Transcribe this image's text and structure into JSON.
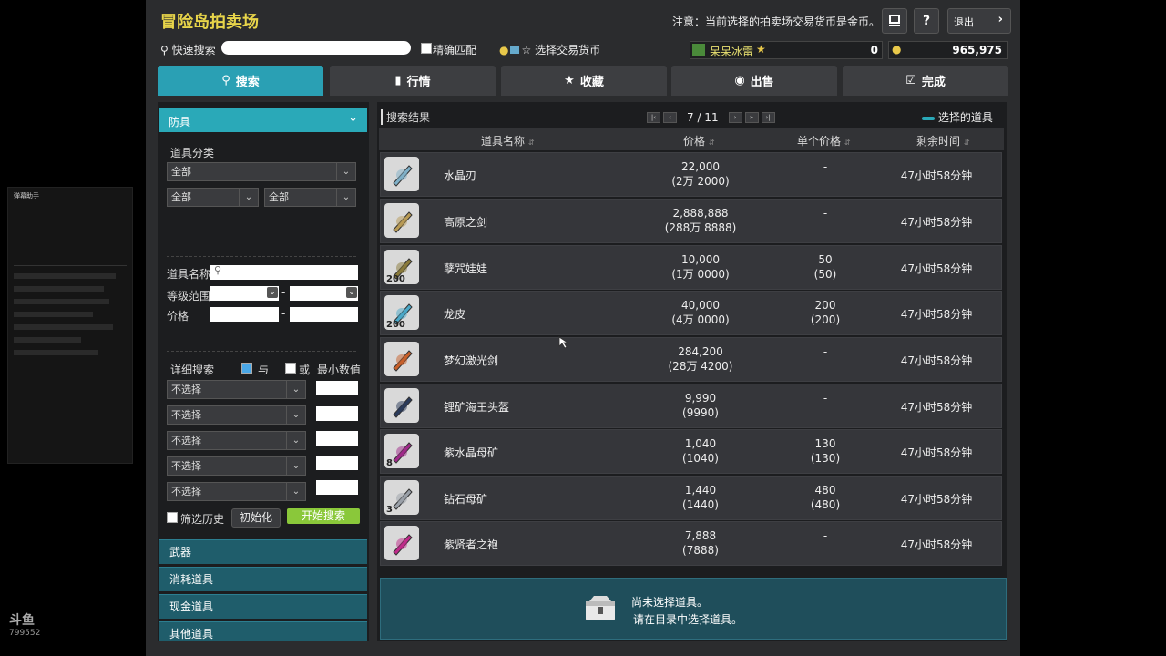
{
  "header": {
    "title": "冒险岛拍卖场",
    "notice": "注意：当前选择的拍卖场交易货币是金币。",
    "quit_label": "退出"
  },
  "search_bar": {
    "quick_search_label": "快速搜索",
    "quick_search_value": "",
    "exact_match_label": "精确匹配",
    "currency_label": "选择交易货币",
    "username": "呆呆冰雷",
    "points": "0",
    "gold": "965,975"
  },
  "tabs": [
    {
      "label": "搜索",
      "icon": "search-icon"
    },
    {
      "label": "行情",
      "icon": "chart-icon"
    },
    {
      "label": "收藏",
      "icon": "star-icon"
    },
    {
      "label": "出售",
      "icon": "coin-icon"
    },
    {
      "label": "完成",
      "icon": "check-icon"
    }
  ],
  "filters": {
    "category": "防具",
    "item_class_label": "道具分类",
    "class_select": "全部",
    "sub_select_1": "全部",
    "sub_select_2": "全部",
    "item_name_label": "道具名称",
    "level_range_label": "等级范围",
    "price_label": "价格",
    "range_sep": "-",
    "detail_label": "详细搜索",
    "and_label": "与",
    "or_label": "或",
    "min_label": "最小数值",
    "detail_options": [
      "不选择",
      "不选择",
      "不选择",
      "不选择",
      "不选择"
    ],
    "history_label": "筛选历史",
    "reset_label": "初始化",
    "start_label": "开始搜索"
  },
  "categories": [
    "武器",
    "消耗道具",
    "现金道具",
    "其他道具"
  ],
  "results": {
    "title": "搜索结果",
    "page": "7 / 11",
    "selected_label": "选择的道具",
    "columns": [
      "道具名称",
      "价格",
      "单个价格",
      "剩余时间"
    ],
    "rows": [
      {
        "name": "水晶刃",
        "price": "22,000",
        "price_sub": "(2万 2000)",
        "unit": "-",
        "unit_sub": "",
        "time": "47小时58分钟",
        "qty": "",
        "color": "#7fb0c8"
      },
      {
        "name": "高原之剑",
        "price": "2,888,888",
        "price_sub": "(288万 8888)",
        "unit": "-",
        "unit_sub": "",
        "time": "47小时58分钟",
        "qty": "",
        "color": "#b89a55"
      },
      {
        "name": "孽咒娃娃",
        "price": "10,000",
        "price_sub": "(1万 0000)",
        "unit": "50",
        "unit_sub": "(50)",
        "time": "47小时58分钟",
        "qty": "200",
        "color": "#8a7a3a"
      },
      {
        "name": "龙皮",
        "price": "40,000",
        "price_sub": "(4万 0000)",
        "unit": "200",
        "unit_sub": "(200)",
        "time": "47小时58分钟",
        "qty": "200",
        "color": "#4aa8c8"
      },
      {
        "name": "梦幻激光剑",
        "price": "284,200",
        "price_sub": "(28万 4200)",
        "unit": "-",
        "unit_sub": "",
        "time": "47小时58分钟",
        "qty": "",
        "color": "#c8602a"
      },
      {
        "name": "锂矿海王头盔",
        "price": "9,990",
        "price_sub": "(9990)",
        "unit": "-",
        "unit_sub": "",
        "time": "47小时58分钟",
        "qty": "",
        "color": "#2a3a5a"
      },
      {
        "name": "紫水晶母矿",
        "price": "1,040",
        "price_sub": "(1040)",
        "unit": "130",
        "unit_sub": "(130)",
        "time": "47小时58分钟",
        "qty": "8",
        "color": "#a02a8a"
      },
      {
        "name": "钻石母矿",
        "price": "1,440",
        "price_sub": "(1440)",
        "unit": "480",
        "unit_sub": "(480)",
        "time": "47小时58分钟",
        "qty": "3",
        "color": "#9aa0a8"
      },
      {
        "name": "紫贤者之袍",
        "price": "7,888",
        "price_sub": "(7888)",
        "unit": "-",
        "unit_sub": "",
        "time": "47小时58分钟",
        "qty": "",
        "color": "#c02a8a"
      }
    ]
  },
  "empty_state": {
    "line1": "尚未选择道具。",
    "line2": "请在目录中选择道具。"
  },
  "overlay": {
    "title": "弹幕助手",
    "logo_text": "斗鱼",
    "logo_id": "799552"
  }
}
